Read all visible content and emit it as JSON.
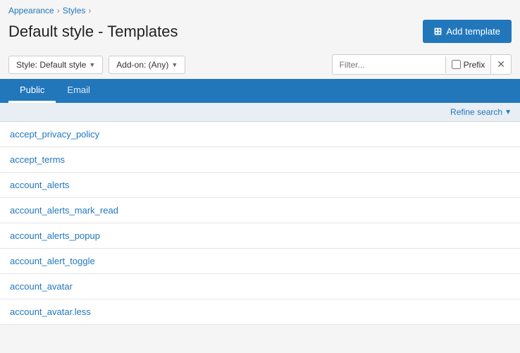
{
  "breadcrumb": {
    "items": [
      {
        "label": "Appearance",
        "href": "#"
      },
      {
        "label": "Styles",
        "href": "#"
      }
    ]
  },
  "page": {
    "title": "Default style - Templates"
  },
  "buttons": {
    "add_template": "Add template"
  },
  "toolbar": {
    "style_dropdown": "Style: Default style",
    "addon_dropdown": "Add-on: (Any)",
    "filter_placeholder": "Filter...",
    "prefix_label": "Prefix"
  },
  "tabs": [
    {
      "id": "public",
      "label": "Public",
      "active": true
    },
    {
      "id": "email",
      "label": "Email",
      "active": false
    }
  ],
  "refine": {
    "label": "Refine search"
  },
  "templates": [
    {
      "name": "accept_privacy_policy"
    },
    {
      "name": "accept_terms"
    },
    {
      "name": "account_alerts"
    },
    {
      "name": "account_alerts_mark_read"
    },
    {
      "name": "account_alerts_popup"
    },
    {
      "name": "account_alert_toggle"
    },
    {
      "name": "account_avatar"
    },
    {
      "name": "account_avatar.less"
    }
  ]
}
